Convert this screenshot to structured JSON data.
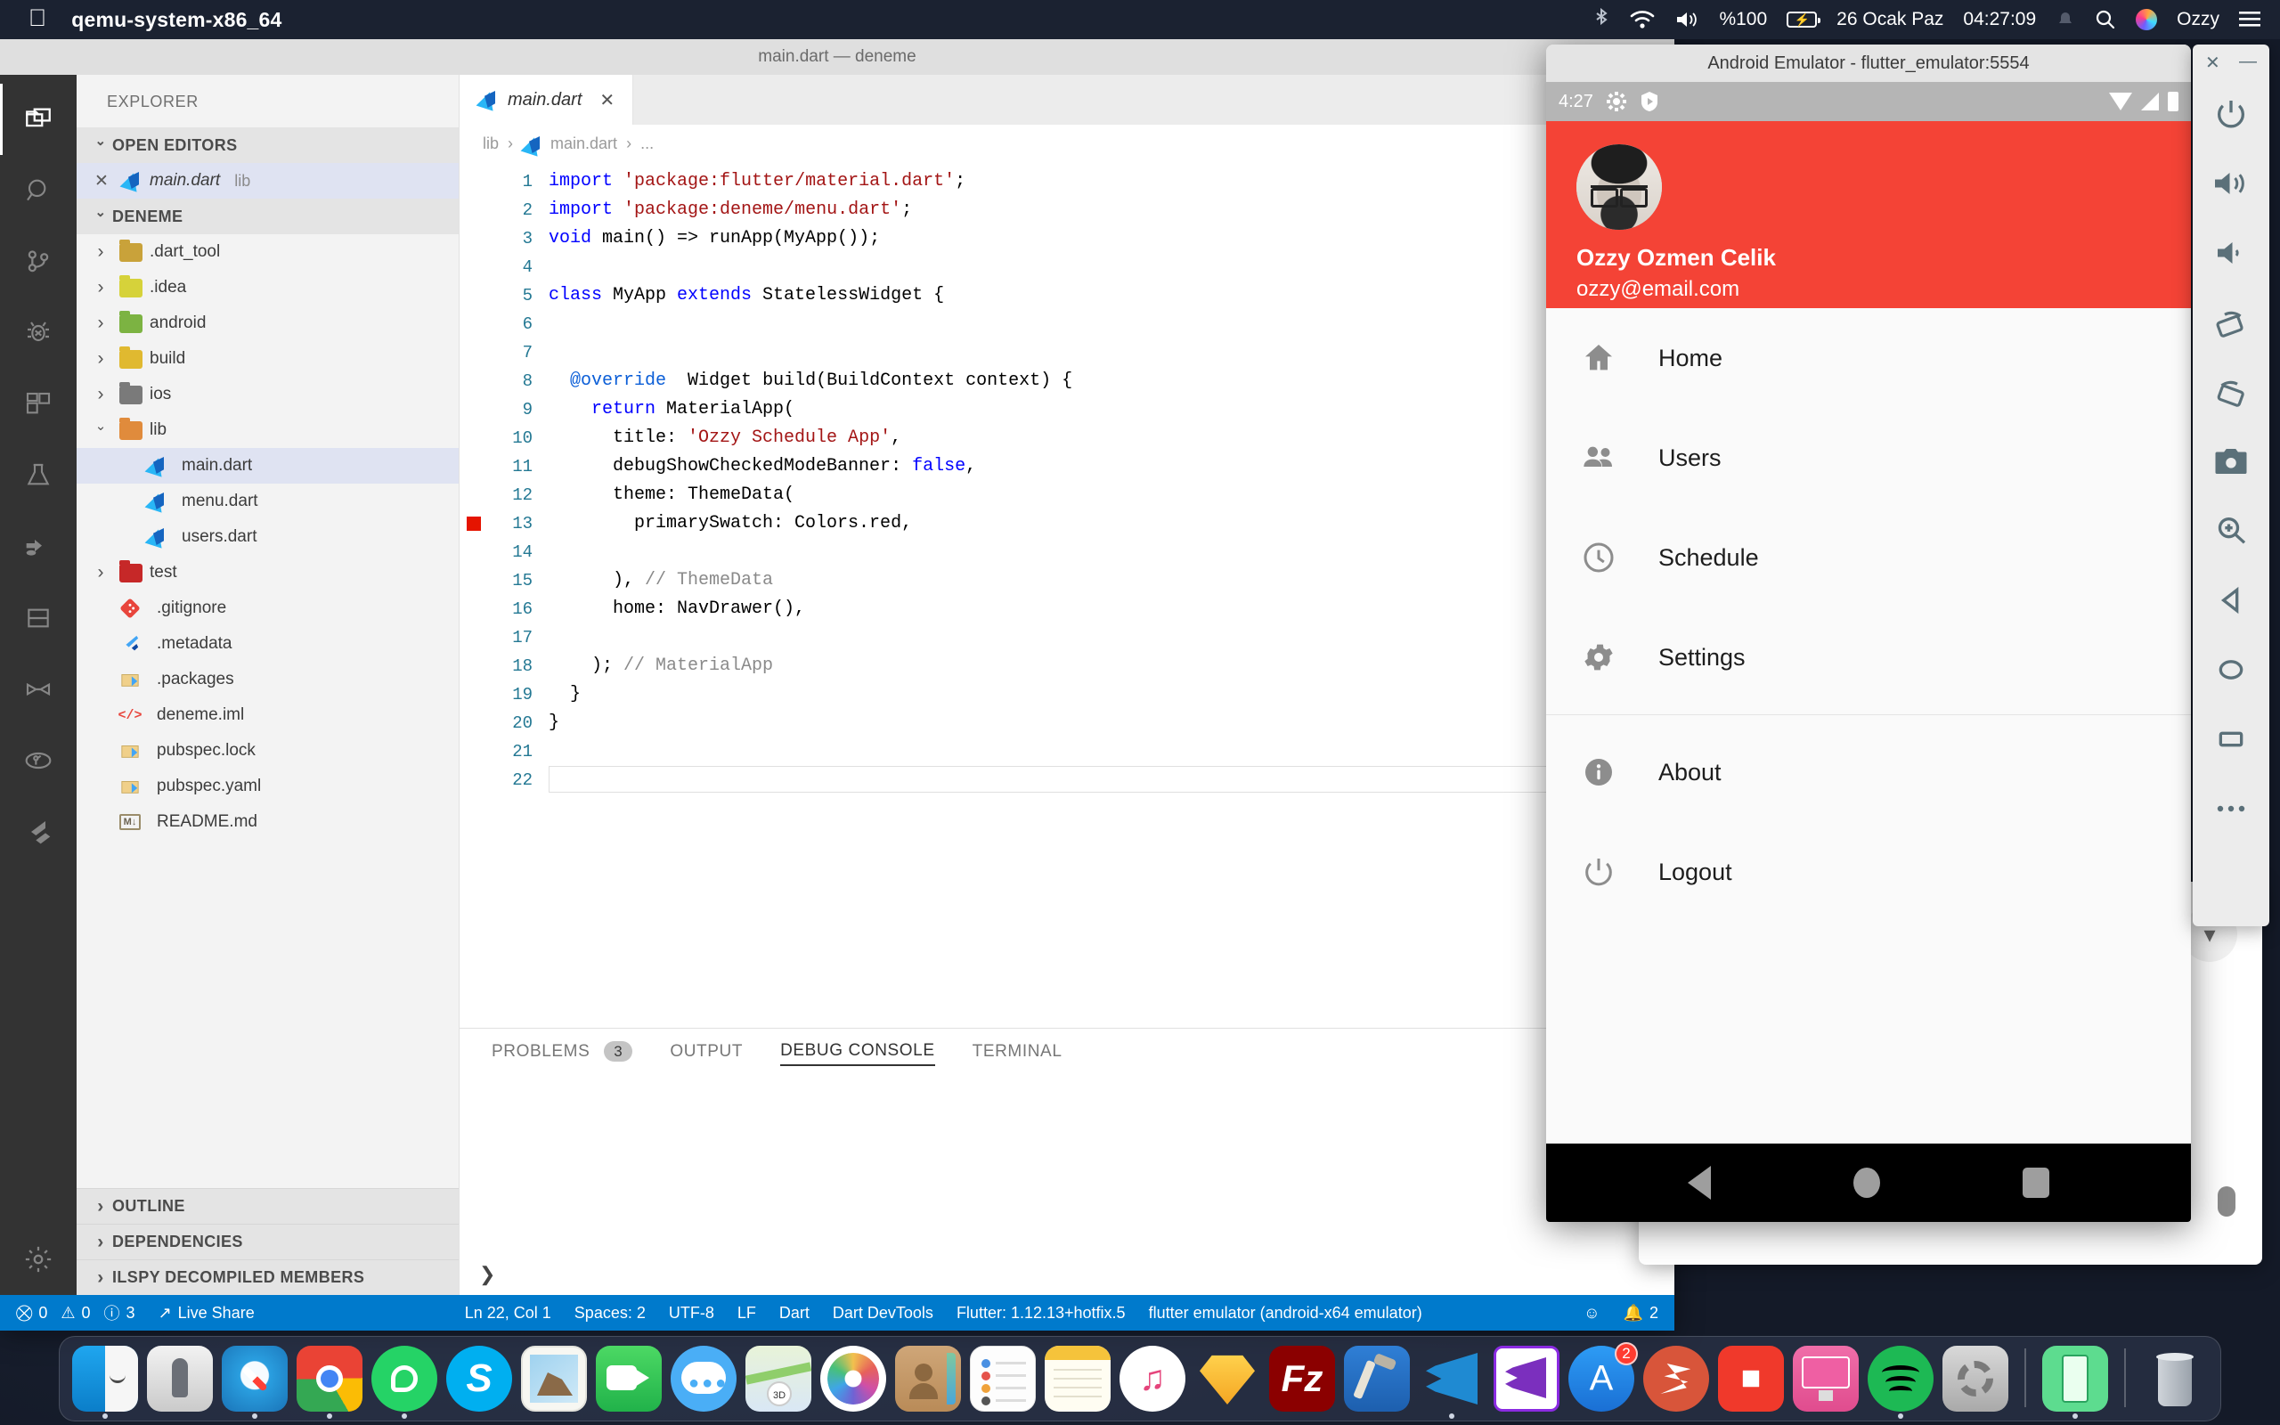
{
  "menubar": {
    "apple_icon": "apple-logo-icon",
    "app_name": "qemu-system-x86_64",
    "bluetooth_icon": "bluetooth-icon",
    "wifi_icon": "wifi-icon",
    "volume_icon": "volume-icon",
    "battery_percent": "%100",
    "battery_icon": "battery-charging-icon",
    "date": "26 Ocak Paz",
    "time": "04:27:09",
    "notification_icon": "bell-icon",
    "search_icon": "spotlight-search-icon",
    "siri_icon": "siri-icon",
    "user": "Ozzy",
    "control_center_icon": "control-center-icon"
  },
  "vscode": {
    "window_title": "main.dart — deneme",
    "activity_bar": [
      {
        "name": "explorer",
        "icon": "files-icon",
        "active": true
      },
      {
        "name": "search",
        "icon": "search-icon",
        "active": false
      },
      {
        "name": "source-control",
        "icon": "source-control-icon",
        "active": false
      },
      {
        "name": "debug",
        "icon": "debug-icon",
        "active": false
      },
      {
        "name": "extensions",
        "icon": "extensions-icon",
        "active": false
      },
      {
        "name": "testing",
        "icon": "beaker-icon",
        "active": false
      },
      {
        "name": "live-share",
        "icon": "live-share-icon",
        "active": false
      },
      {
        "name": "database",
        "icon": "database-icon",
        "active": false
      },
      {
        "name": "bookmarks",
        "icon": "ribbon-icon",
        "active": false
      },
      {
        "name": "gitlens",
        "icon": "gitlens-icon",
        "active": false
      },
      {
        "name": "flutter",
        "icon": "flutter-icon",
        "active": false
      },
      {
        "name": "settings",
        "icon": "gear-icon",
        "active": false
      }
    ],
    "sidebar": {
      "title": "EXPLORER",
      "open_editors": {
        "label": "OPEN EDITORS",
        "items": [
          {
            "name": "main.dart",
            "folder": "lib",
            "icon": "dart-file-icon",
            "close_icon": "close-icon"
          }
        ]
      },
      "project": {
        "label": "DENEME",
        "items": [
          {
            "label": ".dart_tool",
            "type": "folder",
            "expanded": false,
            "color": "#c9a23a"
          },
          {
            "label": ".idea",
            "type": "folder",
            "expanded": false,
            "color": "#d6d23a"
          },
          {
            "label": "android",
            "type": "folder",
            "expanded": false,
            "color": "#7cb342"
          },
          {
            "label": "build",
            "type": "folder",
            "expanded": false,
            "color": "#e0b930"
          },
          {
            "label": "ios",
            "type": "folder",
            "expanded": false,
            "color": "#7a7a7a"
          },
          {
            "label": "lib",
            "type": "folder",
            "expanded": true,
            "color": "#e08b3c"
          },
          {
            "label": "main.dart",
            "type": "file",
            "icon": "dart-file-icon",
            "depth": 2,
            "selected": true
          },
          {
            "label": "menu.dart",
            "type": "file",
            "icon": "dart-file-icon",
            "depth": 2,
            "selected": false
          },
          {
            "label": "users.dart",
            "type": "file",
            "icon": "dart-file-icon",
            "depth": 2,
            "selected": false
          },
          {
            "label": "test",
            "type": "folder",
            "expanded": false,
            "color": "#c62828"
          },
          {
            "label": ".gitignore",
            "type": "file",
            "icon": "git-icon",
            "depth": 1
          },
          {
            "label": ".metadata",
            "type": "file",
            "icon": "flutter-icon",
            "depth": 1
          },
          {
            "label": ".packages",
            "type": "file",
            "icon": "package-icon",
            "depth": 1
          },
          {
            "label": "deneme.iml",
            "type": "file",
            "icon": "code-tag-icon",
            "depth": 1
          },
          {
            "label": "pubspec.lock",
            "type": "file",
            "icon": "package-icon",
            "depth": 1
          },
          {
            "label": "pubspec.yaml",
            "type": "file",
            "icon": "package-icon",
            "depth": 1
          },
          {
            "label": "README.md",
            "type": "file",
            "icon": "markdown-icon",
            "depth": 1
          }
        ]
      },
      "bottom_sections": [
        "OUTLINE",
        "DEPENDENCIES",
        "ILSPY DECOMPILED MEMBERS"
      ]
    },
    "editor": {
      "tab": {
        "label": "main.dart",
        "icon": "dart-file-icon",
        "close_icon": "close-icon"
      },
      "breadcrumb": [
        "lib",
        "main.dart",
        "..."
      ],
      "breadcrumb_icon": "dart-file-icon",
      "breakpoint_line": 13,
      "lines": [
        {
          "n": 1,
          "html": "<span class='kw'>import</span> <span class='str'>'package:flutter/material.dart'</span>;"
        },
        {
          "n": 2,
          "html": "<span class='kw'>import</span> <span class='str'>'package:deneme/menu.dart'</span>;"
        },
        {
          "n": 3,
          "html": "<span class='kw'>void</span> main() => runApp(MyApp());"
        },
        {
          "n": 4,
          "html": ""
        },
        {
          "n": 5,
          "html": "<span class='kw'>class</span> MyApp <span class='kw'>extends</span> StatelessWidget {"
        },
        {
          "n": 6,
          "html": ""
        },
        {
          "n": 7,
          "html": ""
        },
        {
          "n": 8,
          "html": "  <span class='ann'>@override</span>  Widget build(BuildContext context) {"
        },
        {
          "n": 9,
          "html": "    <span class='kw'>return</span> MaterialApp("
        },
        {
          "n": 10,
          "html": "      title: <span class='str'>'Ozzy Schedule App'</span>,"
        },
        {
          "n": 11,
          "html": "      debugShowCheckedModeBanner: <span class='kw'>false</span>,"
        },
        {
          "n": 12,
          "html": "      theme: ThemeData("
        },
        {
          "n": 13,
          "html": "        primarySwatch: Colors.red,"
        },
        {
          "n": 14,
          "html": ""
        },
        {
          "n": 15,
          "html": "      ), <span class='cmt'>// ThemeData</span>"
        },
        {
          "n": 16,
          "html": "      home: NavDrawer(),"
        },
        {
          "n": 17,
          "html": ""
        },
        {
          "n": 18,
          "html": "    ); <span class='cmt'>// MaterialApp</span>"
        },
        {
          "n": 19,
          "html": "  }"
        },
        {
          "n": 20,
          "html": "}"
        },
        {
          "n": 21,
          "html": ""
        },
        {
          "n": 22,
          "html": ""
        }
      ]
    },
    "panel": {
      "tabs": [
        {
          "label": "PROBLEMS",
          "badge": "3",
          "active": false
        },
        {
          "label": "OUTPUT",
          "badge": "",
          "active": false
        },
        {
          "label": "DEBUG CONSOLE",
          "badge": "",
          "active": true
        },
        {
          "label": "TERMINAL",
          "badge": "",
          "active": false
        }
      ],
      "actions_icon": "clear-console-icon",
      "prompt": "❯"
    },
    "statusbar": {
      "errors_icon": "error-icon",
      "errors": "0",
      "warnings_icon": "warning-icon",
      "warnings": "0",
      "info_icon": "info-icon",
      "info": "3",
      "live_share_icon": "live-share-icon",
      "live_share": "Live Share",
      "cursor_position": "Ln 22, Col 1",
      "indentation": "Spaces: 2",
      "encoding": "UTF-8",
      "eol": "LF",
      "language": "Dart",
      "devtools": "Dart DevTools",
      "flutter_version": "Flutter: 1.12.13+hotfix.5",
      "device": "flutter emulator (android-x64 emulator)",
      "feedback_icon": "smiley-icon",
      "bell_icon": "bell-icon",
      "bell_count": "2"
    }
  },
  "emulator": {
    "window_title": "Android Emulator - flutter_emulator:5554",
    "status_bar": {
      "time": "4:27",
      "icons": [
        "gear-icon",
        "play-badge-icon"
      ],
      "right_icons": [
        "wifi-icon",
        "cellular-icon",
        "battery-icon"
      ]
    },
    "drawer": {
      "header_color": "#f44336",
      "avatar_icon": "user-avatar",
      "name": "Ozzy Ozmen Celik",
      "email": "ozzy@email.com",
      "items": [
        {
          "label": "Home",
          "icon": "home-icon"
        },
        {
          "label": "Users",
          "icon": "people-icon"
        },
        {
          "label": "Schedule",
          "icon": "clock-icon"
        },
        {
          "label": "Settings",
          "icon": "gear-icon"
        },
        {
          "label": "About",
          "icon": "info-icon",
          "after_divider": true
        },
        {
          "label": "Logout",
          "icon": "power-icon"
        }
      ]
    },
    "nav_bar": [
      "back-icon",
      "home-icon",
      "recents-icon"
    ],
    "toolbar": {
      "close_icon": "close-icon",
      "minimize_icon": "minimize-icon",
      "buttons": [
        "power-icon",
        "volume-up-icon",
        "volume-down-icon",
        "rotate-left-icon",
        "rotate-right-icon",
        "screenshot-icon",
        "zoom-icon",
        "back-icon",
        "home-icon",
        "overview-icon",
        "more-icon"
      ]
    }
  },
  "dock": {
    "items": [
      {
        "name": "finder",
        "running": true
      },
      {
        "name": "launchpad",
        "running": false
      },
      {
        "name": "safari",
        "running": true
      },
      {
        "name": "chrome",
        "running": true
      },
      {
        "name": "whatsapp",
        "running": true
      },
      {
        "name": "skype",
        "running": false
      },
      {
        "name": "mail",
        "running": false
      },
      {
        "name": "facetime",
        "running": false
      },
      {
        "name": "messages",
        "running": false
      },
      {
        "name": "maps",
        "running": false
      },
      {
        "name": "photos",
        "running": false
      },
      {
        "name": "contacts",
        "running": false
      },
      {
        "name": "reminders",
        "running": false
      },
      {
        "name": "notes",
        "running": false
      },
      {
        "name": "itunes",
        "running": false
      },
      {
        "name": "sketch",
        "running": false
      },
      {
        "name": "filezilla",
        "running": false
      },
      {
        "name": "xcode",
        "running": false
      },
      {
        "name": "vscode",
        "running": true
      },
      {
        "name": "visual-studio",
        "running": false
      },
      {
        "name": "app-store",
        "running": false,
        "badge": "2"
      },
      {
        "name": "sublime",
        "running": false
      },
      {
        "name": "beyond-compare",
        "running": false
      },
      {
        "name": "imac",
        "running": false
      },
      {
        "name": "spotify",
        "running": true
      },
      {
        "name": "system-preferences",
        "running": false
      },
      {
        "name": "downloads",
        "running": true
      },
      {
        "name": "trash",
        "running": false
      }
    ]
  }
}
